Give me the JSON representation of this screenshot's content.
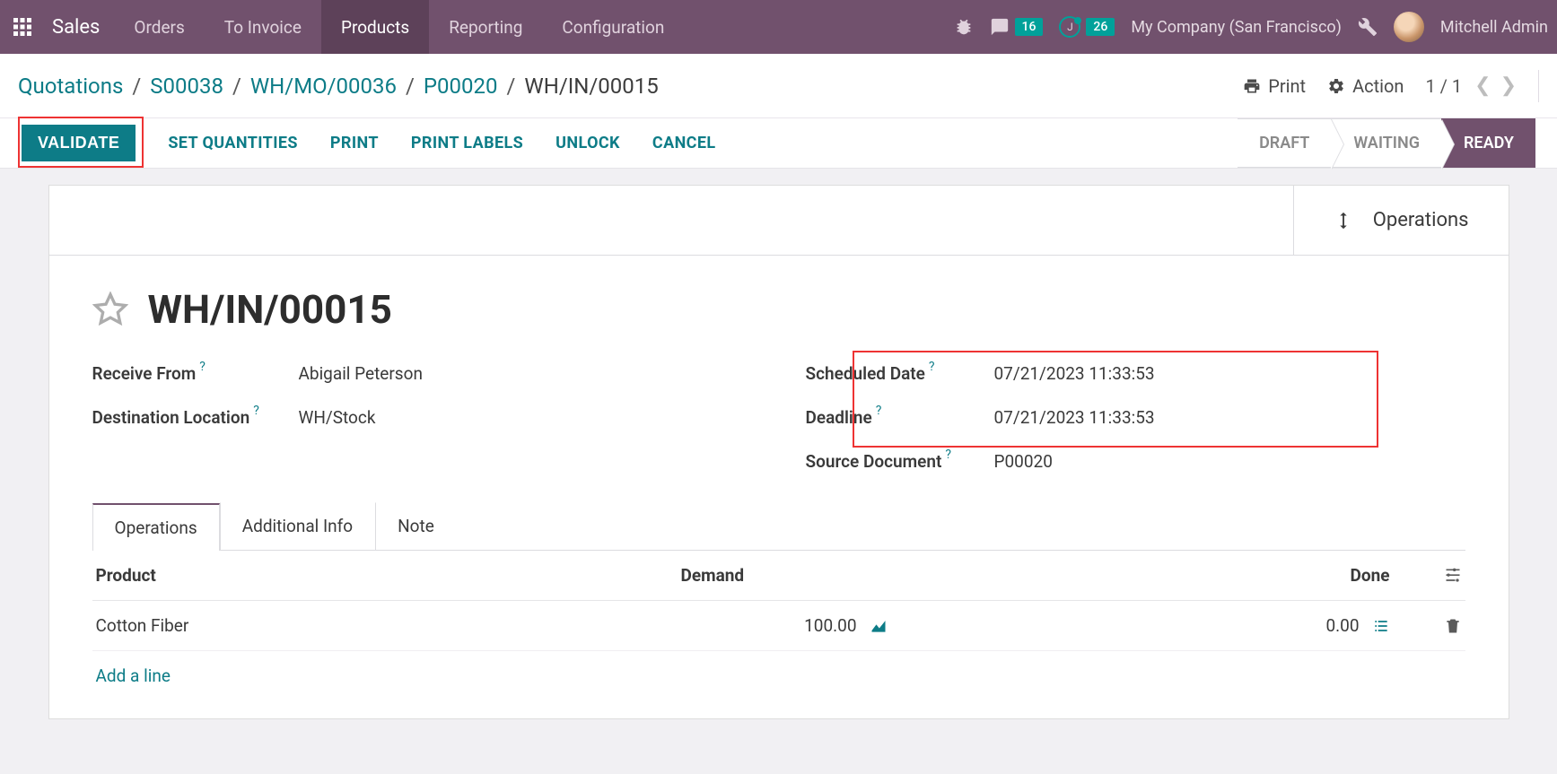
{
  "app": {
    "name": "Sales"
  },
  "nav": {
    "items": [
      {
        "label": "Orders",
        "active": false
      },
      {
        "label": "To Invoice",
        "active": false
      },
      {
        "label": "Products",
        "active": true
      },
      {
        "label": "Reporting",
        "active": false
      },
      {
        "label": "Configuration",
        "active": false
      }
    ]
  },
  "topbar": {
    "messages_badge": "16",
    "activities_badge": "26",
    "activities_letter": "J",
    "company": "My Company (San Francisco)",
    "user": "Mitchell Admin"
  },
  "breadcrumbs": {
    "items": [
      {
        "label": "Quotations",
        "link": true
      },
      {
        "label": "S00038",
        "link": true
      },
      {
        "label": "WH/MO/00036",
        "link": true
      },
      {
        "label": "P00020",
        "link": true
      },
      {
        "label": "WH/IN/00015",
        "link": false
      }
    ]
  },
  "breadcrumb_actions": {
    "print": "Print",
    "action": "Action",
    "pager": "1 / 1"
  },
  "toolbar": {
    "validate": "VALIDATE",
    "set_quantities": "SET QUANTITIES",
    "print": "PRINT",
    "print_labels": "PRINT LABELS",
    "unlock": "UNLOCK",
    "cancel": "CANCEL"
  },
  "status": {
    "steps": [
      {
        "label": "DRAFT",
        "active": false
      },
      {
        "label": "WAITING",
        "active": false
      },
      {
        "label": "READY",
        "active": true
      }
    ]
  },
  "sheet_header": {
    "operations_btn": "Operations"
  },
  "doc": {
    "title": "WH/IN/00015",
    "left": {
      "receive_from_label": "Receive From",
      "receive_from_value": "Abigail Peterson",
      "destination_label": "Destination Location",
      "destination_value": "WH/Stock"
    },
    "right": {
      "scheduled_label": "Scheduled Date",
      "scheduled_value": "07/21/2023 11:33:53",
      "deadline_label": "Deadline",
      "deadline_value": "07/21/2023 11:33:53",
      "source_doc_label": "Source Document",
      "source_doc_value": "P00020"
    }
  },
  "tabs": {
    "items": [
      {
        "label": "Operations",
        "active": true
      },
      {
        "label": "Additional Info",
        "active": false
      },
      {
        "label": "Note",
        "active": false
      }
    ]
  },
  "optable": {
    "head": {
      "product": "Product",
      "demand": "Demand",
      "done": "Done"
    },
    "rows": [
      {
        "product": "Cotton Fiber",
        "demand": "100.00",
        "done": "0.00"
      }
    ],
    "add_line": "Add a line"
  }
}
